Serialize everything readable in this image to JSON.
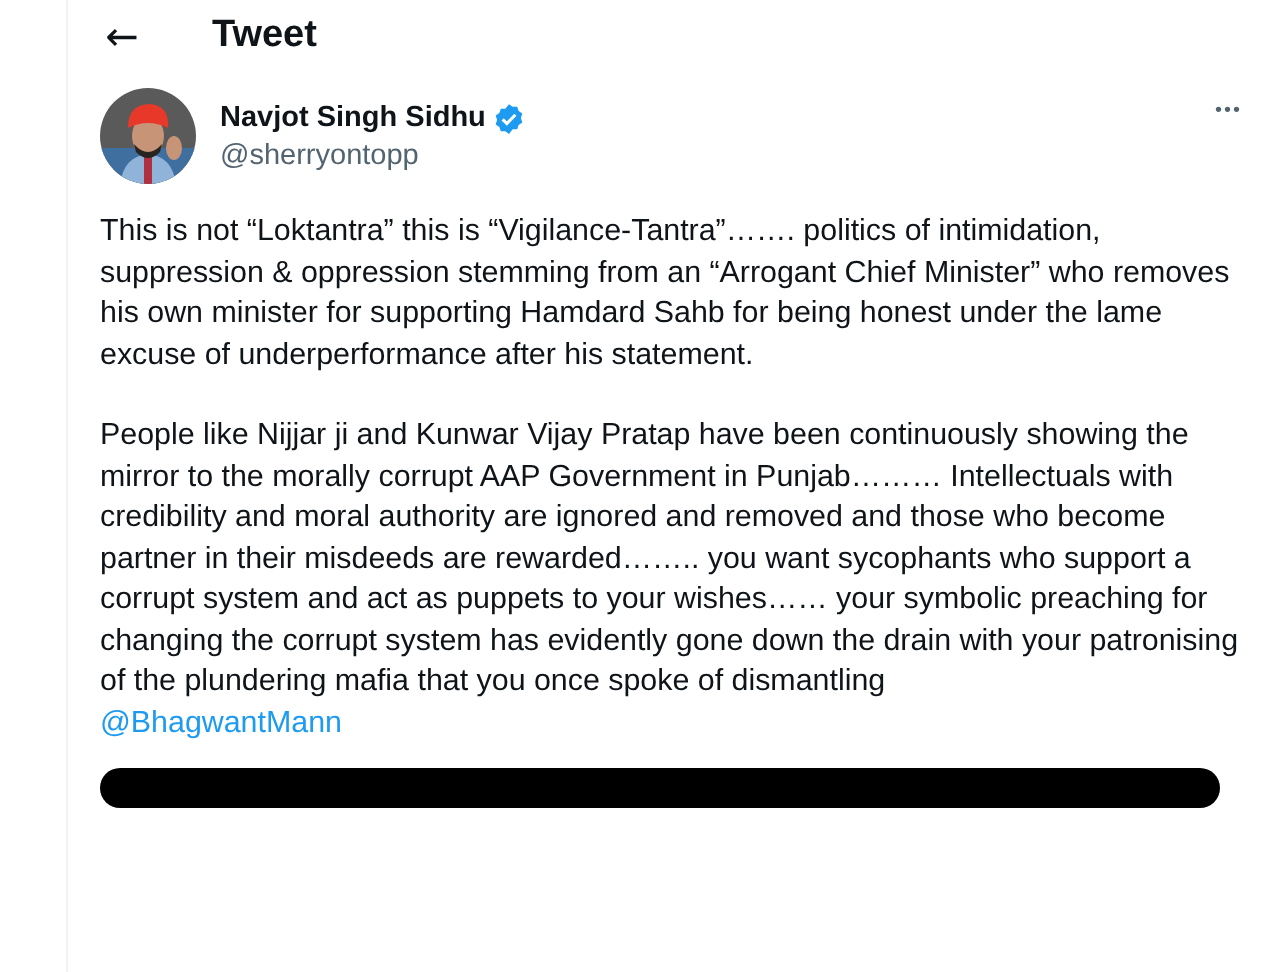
{
  "header": {
    "back": "←",
    "title": "Tweet"
  },
  "author": {
    "name": "Navjot Singh Sidhu",
    "verified": true,
    "handle": "@sherryontopp",
    "more": "•••"
  },
  "paragraphs": [
    {
      "text": "This is not “Loktantra” this is “Vigilance-Tantra”……. politics of intimidation, suppression & oppression stemming from an “Arrogant Chief Minister” who removes his own minister for supporting Hamdard Sahb for being honest under the lame excuse of underperformance after his statement."
    },
    {
      "text": "People like Nijjar ji and Kunwar Vijay Pratap have been continuously showing the mirror to the morally corrupt AAP Government in Punjab……… Intellectuals with credibility and moral authority are ignored and removed and those who become partner in their misdeeds are rewarded…….. you want sycophants who support a corrupt system and act as puppets to your wishes…… your symbolic preaching for changing the corrupt system has evidently gone down the drain with your patronising of the plundering mafia that you once spoke of dismantling",
      "mention": "@BhagwantMann"
    }
  ]
}
